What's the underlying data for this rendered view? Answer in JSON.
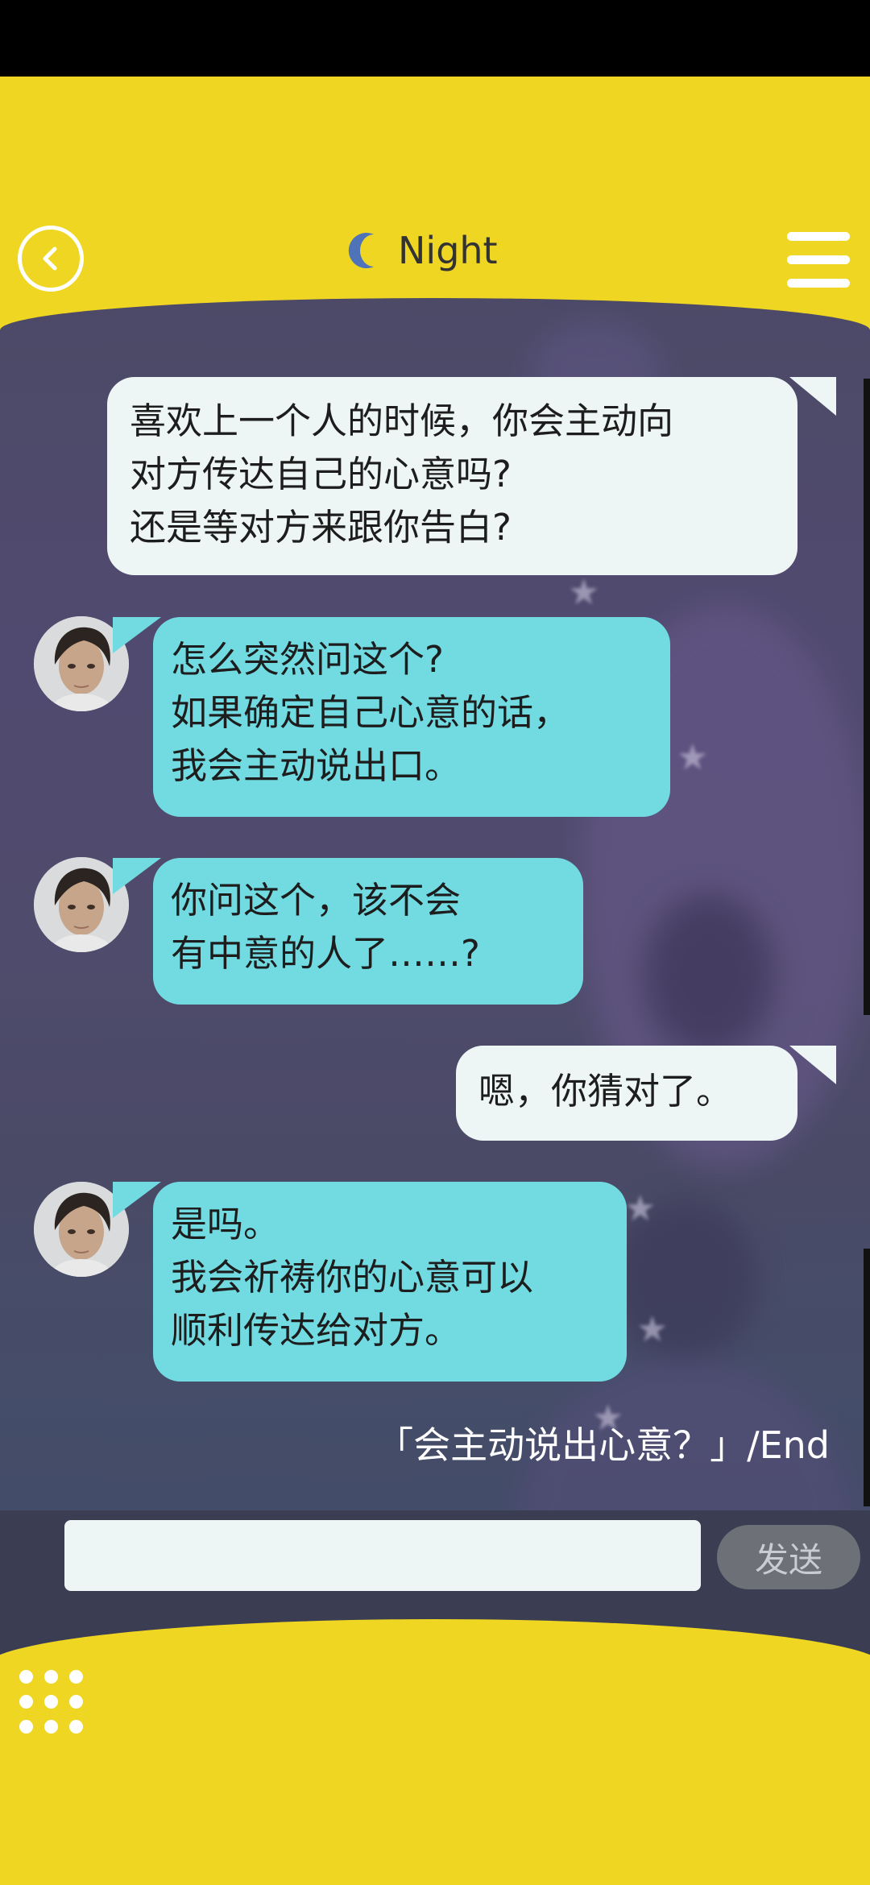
{
  "header": {
    "title": "Night",
    "moon_icon": "crescent-moon-icon",
    "back_icon": "chevron-left-icon",
    "menu_icon": "hamburger-menu-icon"
  },
  "messages": [
    {
      "sender": "user",
      "text": "喜欢上一个人的时候，你会主动向\n对方传达自己的心意吗?\n还是等对方来跟你告白?"
    },
    {
      "sender": "bot",
      "text": "怎么突然问这个?\n如果确定自己心意的话，\n我会主动说出口。"
    },
    {
      "sender": "bot",
      "text": "你问这个，该不会\n有中意的人了……?"
    },
    {
      "sender": "user",
      "text": "嗯，你猜对了。"
    },
    {
      "sender": "bot",
      "text": "是吗。\n我会祈祷你的心意可以\n顺利传达给对方。"
    }
  ],
  "end_label": "「会主动说出心意？」/End",
  "input": {
    "value": "",
    "placeholder": ""
  },
  "send_label": "发送",
  "grid_icon": "grid-menu-icon",
  "colors": {
    "accent_yellow": "#efd622",
    "bot_bubble": "#72dbe2",
    "user_bubble": "#eef6f5",
    "moon": "#4e73b8"
  }
}
